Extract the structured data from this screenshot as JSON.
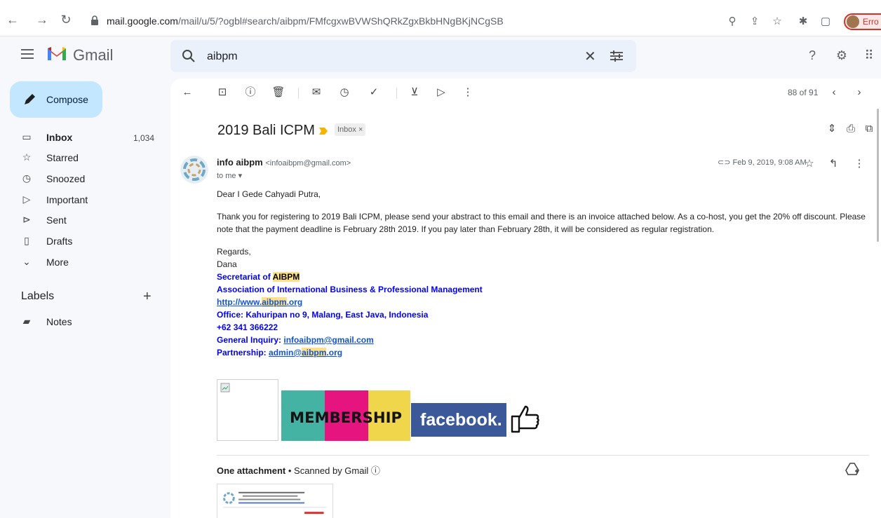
{
  "browser": {
    "url_host": "mail.google.com",
    "url_path": "/mail/u/5/?ogbl#search/aibpm/FMfcgxwBVWShQRkZgxBkbHNgBKjNCgSB",
    "profile_label": "Erro"
  },
  "app": {
    "name": "Gmail"
  },
  "search": {
    "query": "aibpm"
  },
  "sidebar": {
    "compose": "Compose",
    "items": [
      {
        "label": "Inbox",
        "count": "1,034",
        "icon": "inbox-icon"
      },
      {
        "label": "Starred",
        "count": "",
        "icon": "star-icon"
      },
      {
        "label": "Snoozed",
        "count": "",
        "icon": "clock-icon"
      },
      {
        "label": "Important",
        "count": "",
        "icon": "important-icon"
      },
      {
        "label": "Sent",
        "count": "",
        "icon": "send-icon"
      },
      {
        "label": "Drafts",
        "count": "",
        "icon": "draft-icon"
      },
      {
        "label": "More",
        "count": "",
        "icon": "chevron-down-icon"
      }
    ],
    "labels_title": "Labels",
    "labels": [
      {
        "label": "Notes",
        "icon": "label-icon"
      }
    ]
  },
  "toolbar": {
    "pager": "88 of 91"
  },
  "email": {
    "subject": "2019 Bali ICPM",
    "label_chip": "Inbox ×",
    "sender_name": "info aibpm",
    "sender_email": "<infoaibpm@gmail.com>",
    "to": "to me ▾",
    "date": "Feb 9, 2019, 9:08 AM",
    "greeting": "Dear I Gede Cahyadi Putra,",
    "paragraph": "Thank you for registering to 2019 Bali ICPM, please send your abstract to this email and there is an invoice attached below. As a co-host, you get the 20% off discount. Please note that the payment deadline is February 28th 2019. If you pay later than February 28th, it will be considered as regular registration.",
    "regards": "Regards,",
    "name": "Dana",
    "sig": {
      "secretariat_prefix": "Secretariat of ",
      "secretariat_hl": "AIBPM",
      "association": "Association of International Business & Professional Management",
      "url_a": "http://www.",
      "url_b": "aibpm",
      "url_c": ".org",
      "office": "Office: Kahuripan no 9, Malang, East Java, Indonesia",
      "phone": "+62 341 366222",
      "inquiry_label": "General Inquiry: ",
      "inquiry_email": "infoaibpm@gmail.com",
      "partner_label": "Partnership: ",
      "partner_a": "admin@",
      "partner_b": "aibpm",
      "partner_c": ".org"
    },
    "banner_membership": "MEMBERSHIP",
    "banner_facebook": "facebook.",
    "attachment_count": "One attachment",
    "attachment_scan": " • Scanned by Gmail ⓘ"
  }
}
